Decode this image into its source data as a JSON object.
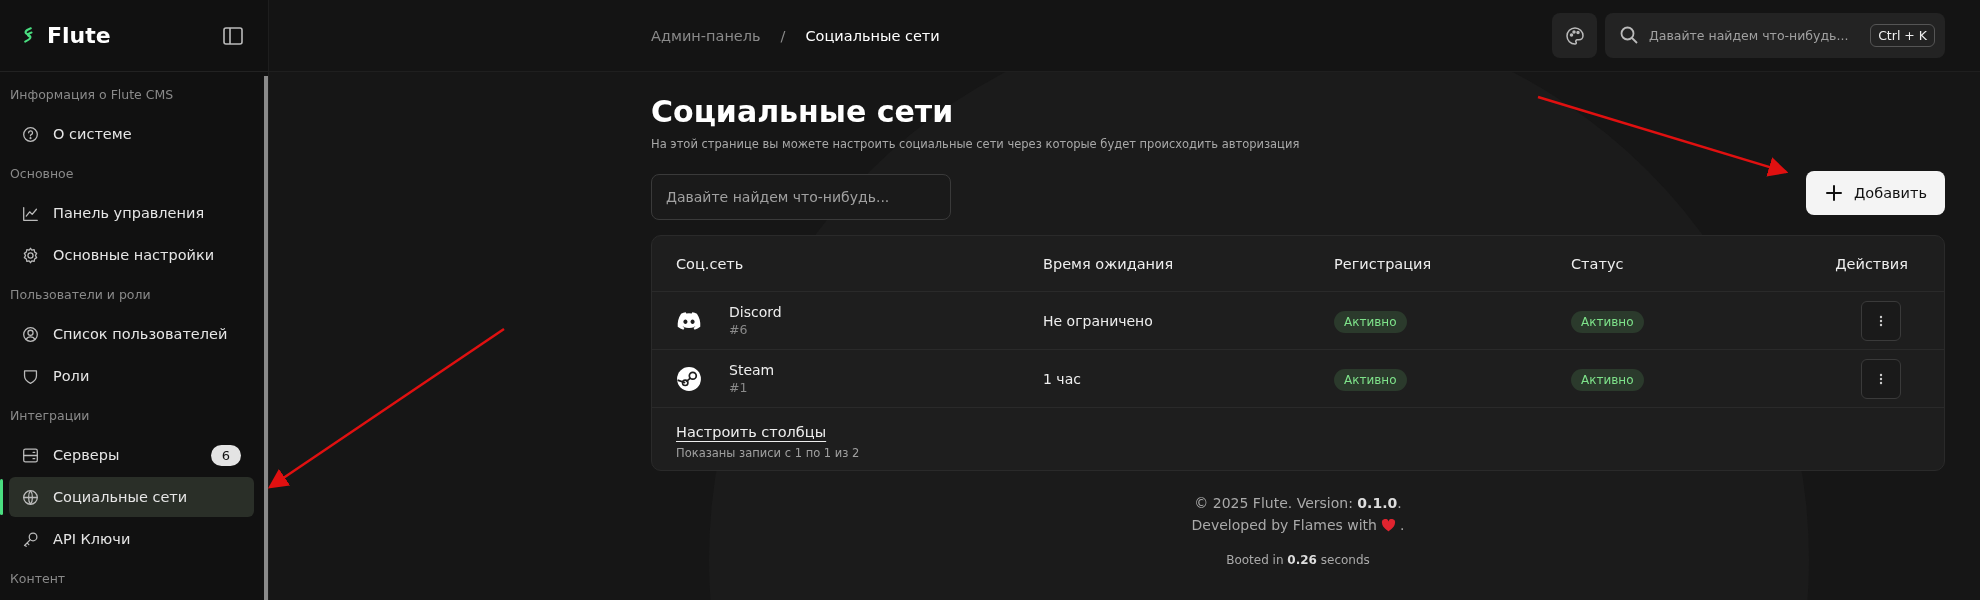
{
  "sidebar": {
    "brand": "Flute",
    "sections": [
      {
        "title": "Информация о Flute CMS",
        "items": [
          {
            "label": "О системе",
            "selected": false
          }
        ]
      },
      {
        "title": "Основное",
        "items": [
          {
            "label": "Панель управления",
            "selected": false
          },
          {
            "label": "Основные настройки",
            "selected": false
          }
        ]
      },
      {
        "title": "Пользователи и роли",
        "items": [
          {
            "label": "Список пользователей",
            "selected": false
          },
          {
            "label": "Роли",
            "selected": false
          }
        ]
      },
      {
        "title": "Интеграции",
        "items": [
          {
            "label": "Серверы",
            "selected": false,
            "badge": "6"
          },
          {
            "label": "Социальные сети",
            "selected": true
          },
          {
            "label": "API Ключи",
            "selected": false
          }
        ]
      },
      {
        "title": "Контент"
      }
    ]
  },
  "breadcrumbs": [
    "Админ-панель",
    "/",
    "Социальные сети"
  ],
  "top_search": {
    "placeholder": "Давайте найдем что-нибудь...",
    "shortcut": "Ctrl + K"
  },
  "page": {
    "title": "Социальные сети",
    "subtitle": "На этой странице вы можете настроить социальные сети через которые будет происходить авторизация",
    "search": {
      "placeholder": "Давайте найдем что-нибудь..."
    },
    "add_button": "Добавить"
  },
  "table": {
    "columns": [
      "Соц.сеть",
      "Время ожидания",
      "Регистрация",
      "Статус",
      "Действия"
    ],
    "rows": [
      {
        "name": "Discord",
        "id": "#6",
        "timeout": "Не ограничено",
        "registration": "Активно",
        "status": "Активно"
      },
      {
        "name": "Steam",
        "id": "#1",
        "timeout": "1 час",
        "registration": "Активно",
        "status": "Активно"
      }
    ],
    "configure_link": "Настроить столбцы",
    "summary": "Показаны записи с 1 по 1 из 2"
  },
  "footer": {
    "copyright": "© 2025 Flute. Version: **0.1.0**.",
    "developed": "Developed by Flames with",
    "developed_end": ".",
    "booted": "Booted in **0.26** seconds"
  }
}
